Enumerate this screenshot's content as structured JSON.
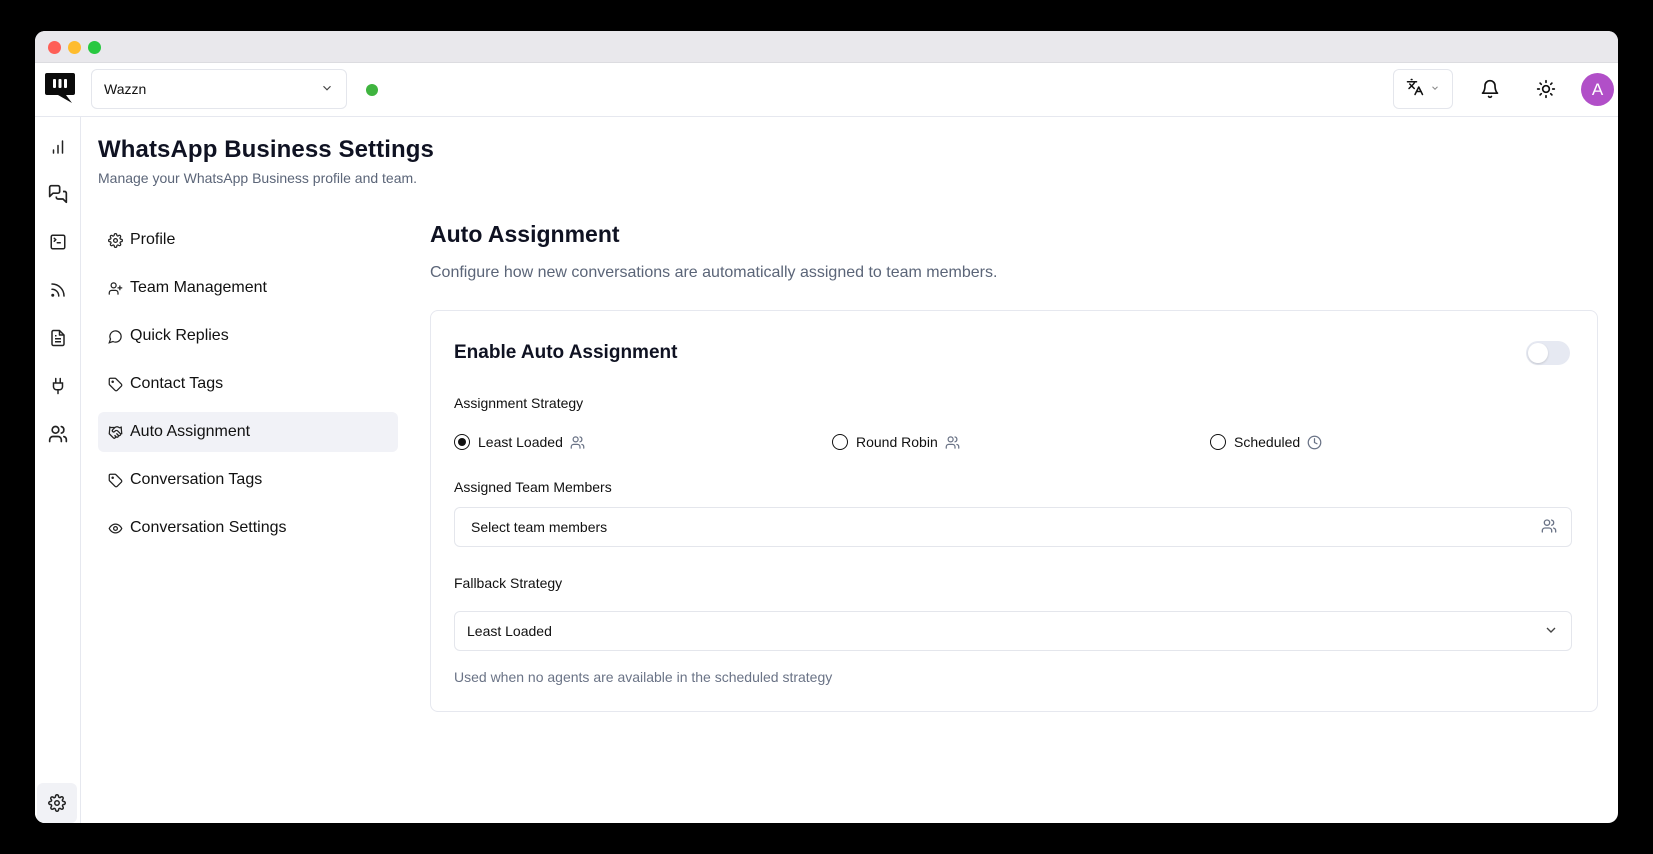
{
  "workspace": {
    "name": "Wazzn"
  },
  "page": {
    "title": "WhatsApp Business Settings",
    "subtitle": "Manage your WhatsApp Business profile and team."
  },
  "rail": {
    "items": [
      {
        "icon": "bar-chart-icon"
      },
      {
        "icon": "chat-icon"
      },
      {
        "icon": "terminal-icon"
      },
      {
        "icon": "rss-icon"
      },
      {
        "icon": "file-text-icon"
      },
      {
        "icon": "plug-icon"
      },
      {
        "icon": "users-icon"
      }
    ],
    "bottom": {
      "icon": "gear-icon"
    }
  },
  "settings_nav": {
    "items": [
      {
        "label": "Profile",
        "icon": "gear-icon"
      },
      {
        "label": "Team Management",
        "icon": "user-plus-icon"
      },
      {
        "label": "Quick Replies",
        "icon": "message-circle-icon"
      },
      {
        "label": "Contact Tags",
        "icon": "tag-icon"
      },
      {
        "label": "Auto Assignment",
        "icon": "handshake-icon",
        "active": true
      },
      {
        "label": "Conversation Tags",
        "icon": "tag-icon"
      },
      {
        "label": "Conversation Settings",
        "icon": "eye-icon"
      }
    ]
  },
  "section": {
    "title": "Auto Assignment",
    "subtitle": "Configure how new conversations are automatically assigned to team members."
  },
  "card": {
    "title": "Enable Auto Assignment",
    "toggle_on": false,
    "strategy_label": "Assignment Strategy",
    "strategies": [
      {
        "label": "Least Loaded",
        "selected": true,
        "icon": "users-icon"
      },
      {
        "label": "Round Robin",
        "selected": false,
        "icon": "users-icon"
      },
      {
        "label": "Scheduled",
        "selected": false,
        "icon": "clock-icon"
      }
    ],
    "members_label": "Assigned Team Members",
    "members_placeholder": "Select team members",
    "fallback_label": "Fallback Strategy",
    "fallback_value": "Least Loaded",
    "fallback_help": "Used when no agents are available in the scheduled strategy"
  },
  "colors": {
    "accent_avatar": "#b14fc8",
    "status_online": "#3fb43f",
    "muted_text": "#5b6578"
  },
  "user": {
    "avatar_initial": "A"
  }
}
